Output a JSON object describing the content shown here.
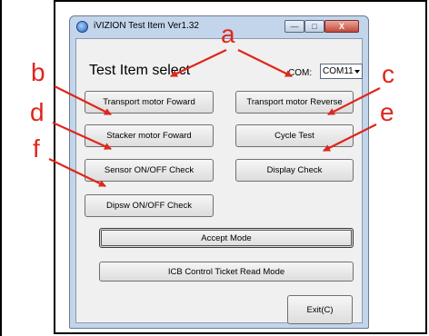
{
  "window": {
    "title": "iVIZION Test Item Ver1.32",
    "min_label": "—",
    "max_label": "□",
    "close_label": "X"
  },
  "heading": "Test Item select",
  "com": {
    "label": "COM:",
    "value": "COM11"
  },
  "buttons": {
    "transport_forward": "Transport motor Foward",
    "transport_reverse": "Transport motor Reverse",
    "stacker_forward": "Stacker motor Foward",
    "cycle_test": "Cycle Test",
    "sensor_check": "Sensor ON/OFF Check",
    "display_check": "Display Check",
    "dipsw_check": "Dipsw ON/OFF Check",
    "accept_mode": "Accept Mode",
    "icb_control": "ICB Control Ticket Read Mode",
    "exit": "Exit(C)"
  },
  "callouts": {
    "a": "a",
    "b": "b",
    "c": "c",
    "d": "d",
    "e": "e",
    "f": "f",
    "color": "#e0261c"
  }
}
